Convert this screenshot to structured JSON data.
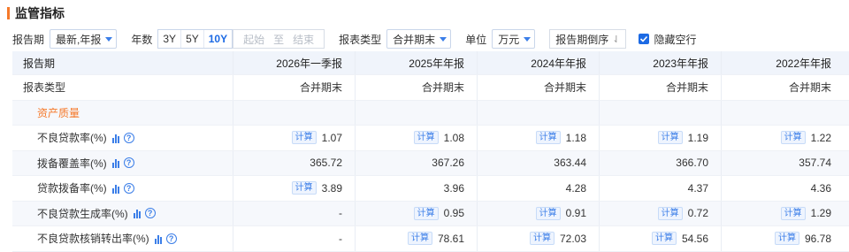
{
  "header": {
    "title": "监管指标"
  },
  "toolbar": {
    "report_period_label": "报告期",
    "report_period_value": "最新,年报",
    "years_label": "年数",
    "years_options": [
      "3Y",
      "5Y",
      "10Y"
    ],
    "years_selected": "10Y",
    "date_start": "起始",
    "date_to": "至",
    "date_end": "结束",
    "report_type_label": "报表类型",
    "report_type_value": "合并期末",
    "unit_label": "单位",
    "unit_value": "万元",
    "sort_label": "报告期倒序",
    "hide_empty_label": "隐藏空行",
    "hide_empty_checked": true
  },
  "table": {
    "period_header": "报告期",
    "periods": [
      "2026年一季报",
      "2025年年报",
      "2024年年报",
      "2023年年报",
      "2022年年报"
    ],
    "report_type_header": "报表类型",
    "report_types": [
      "合并期末",
      "合并期末",
      "合并期末",
      "合并期末",
      "合并期末"
    ],
    "section_title": "资产质量",
    "calc_label": "计算",
    "rows": [
      {
        "label": "不良贷款率(%)",
        "values": [
          "1.07",
          "1.08",
          "1.18",
          "1.19",
          "1.22"
        ],
        "calc": [
          true,
          true,
          true,
          true,
          true
        ]
      },
      {
        "label": "拨备覆盖率(%)",
        "values": [
          "365.72",
          "367.26",
          "363.44",
          "366.70",
          "357.74"
        ],
        "calc": [
          false,
          false,
          false,
          false,
          false
        ]
      },
      {
        "label": "贷款拨备率(%)",
        "values": [
          "3.89",
          "3.96",
          "4.28",
          "4.37",
          "4.36"
        ],
        "calc": [
          true,
          false,
          false,
          false,
          false
        ]
      },
      {
        "label": "不良贷款生成率(%)",
        "values": [
          "-",
          "0.95",
          "0.91",
          "0.72",
          "1.29"
        ],
        "calc": [
          false,
          true,
          true,
          true,
          true
        ]
      },
      {
        "label": "不良贷款核销转出率(%)",
        "values": [
          "-",
          "78.61",
          "72.03",
          "54.56",
          "96.78"
        ],
        "calc": [
          false,
          true,
          true,
          true,
          true
        ]
      }
    ]
  },
  "colors": {
    "accent": "#f5792a",
    "brand_blue": "#1c6ae4",
    "header_bg": "#f0f4fb"
  }
}
